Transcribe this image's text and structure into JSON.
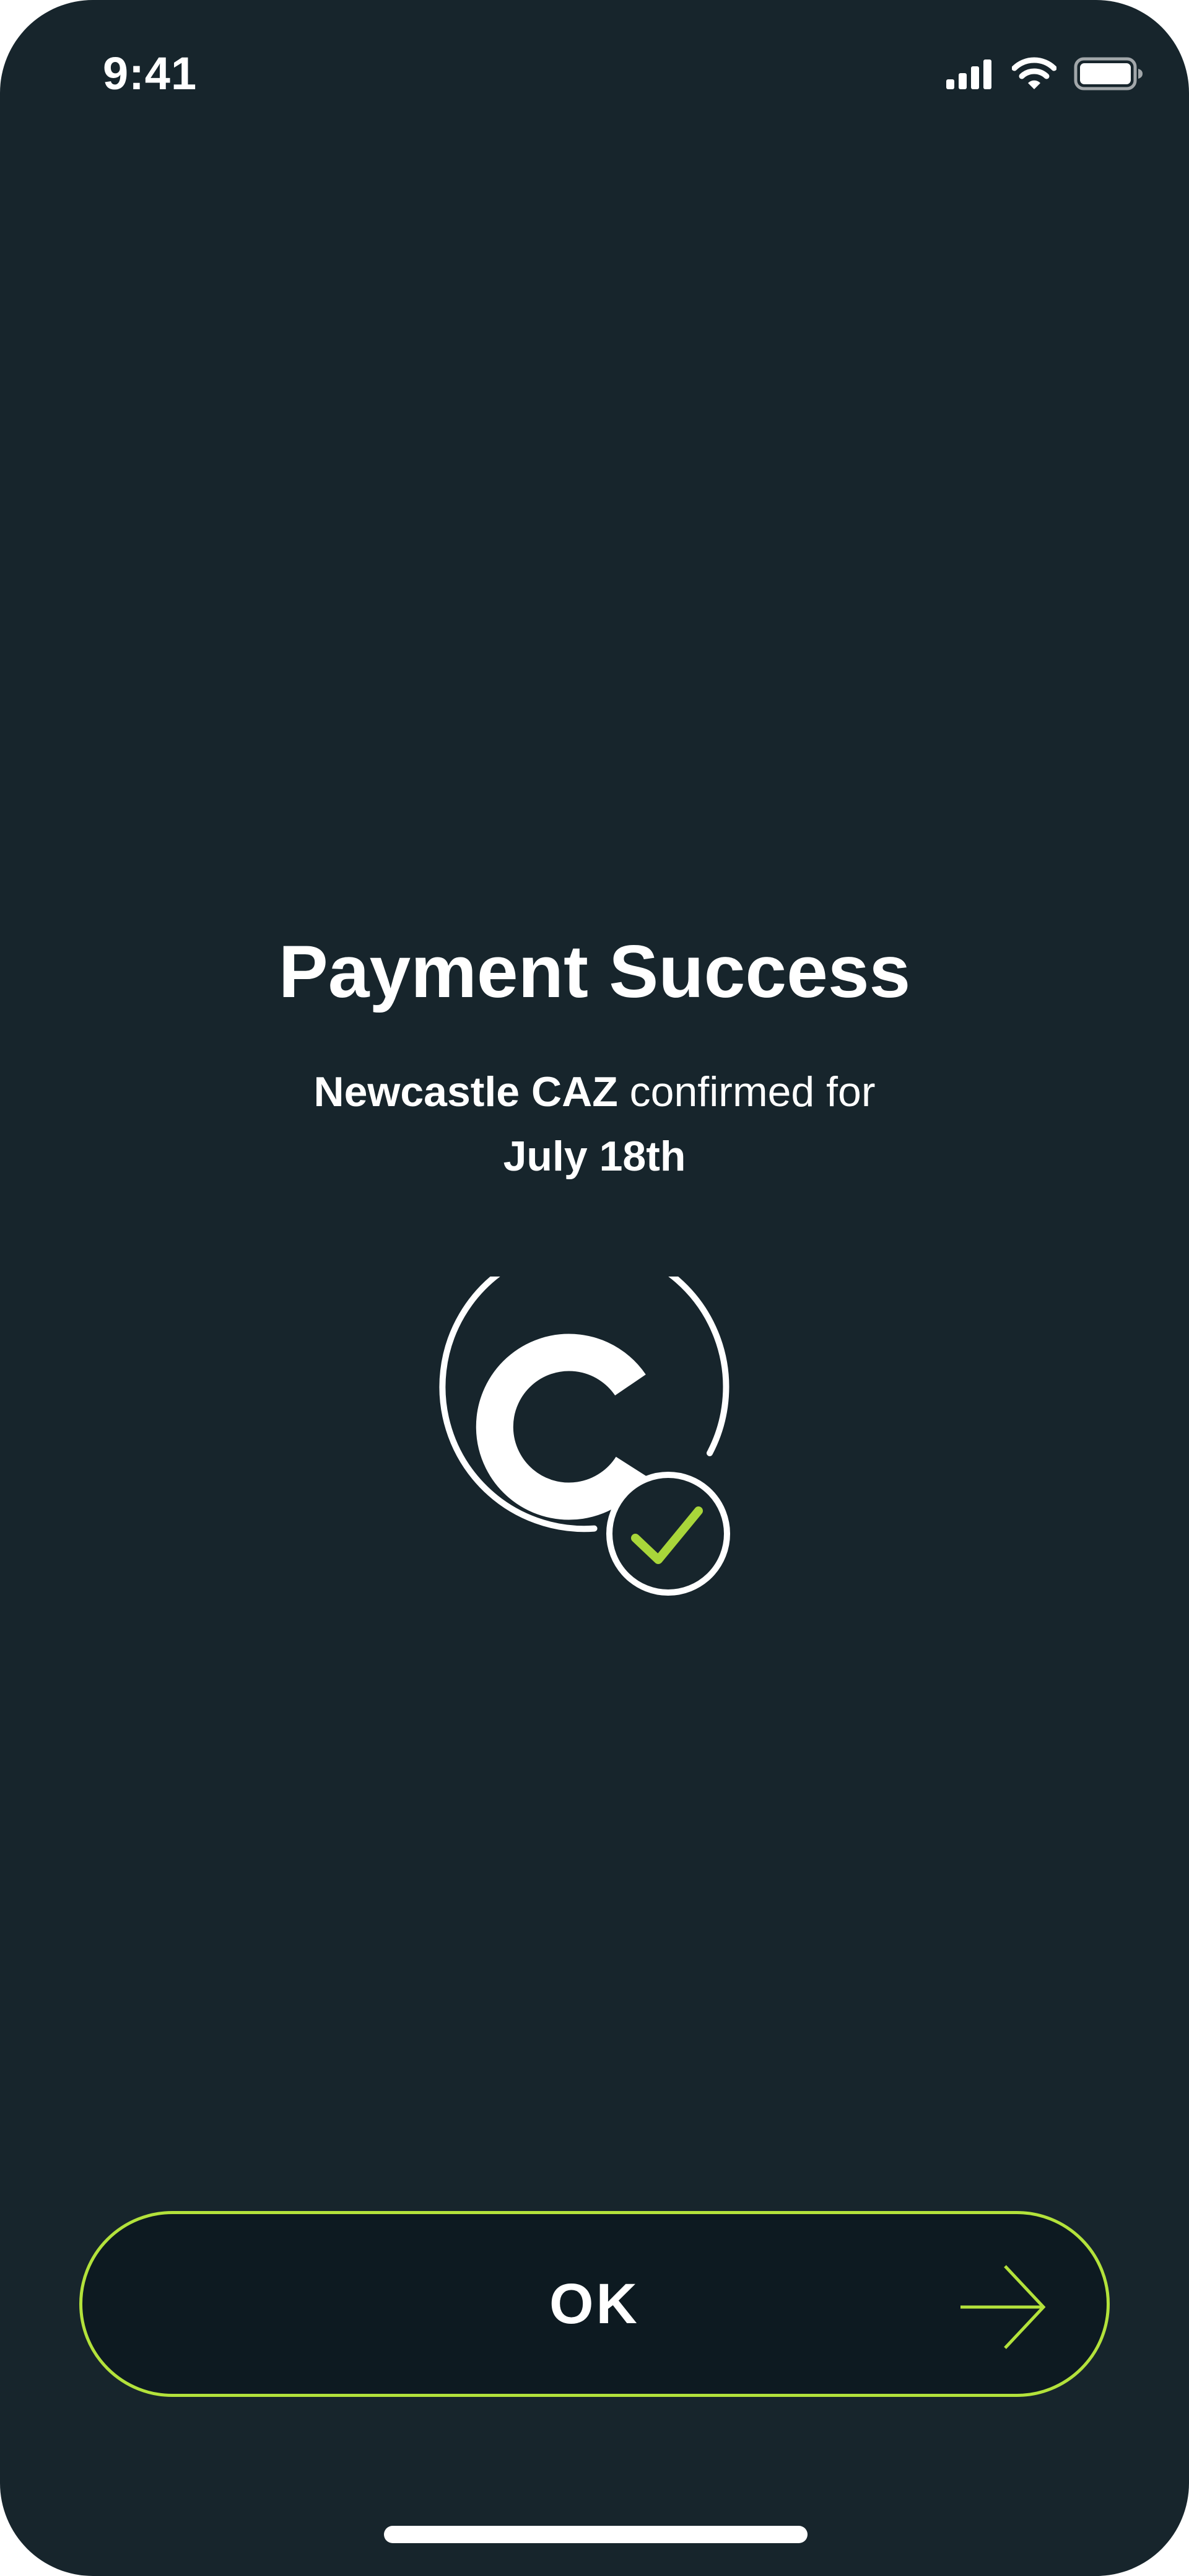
{
  "status_bar": {
    "time": "9:41",
    "icons": [
      "cellular-signal-icon",
      "wifi-icon",
      "battery-icon"
    ]
  },
  "content": {
    "title": "Payment Success",
    "zone": "Newcastle CAZ",
    "confirmed_text": " confirmed for",
    "date": "July 18th",
    "logo_icon": "caz-logo-check-icon"
  },
  "button": {
    "label": "OK",
    "icon": "arrow-right-icon"
  },
  "colors": {
    "background": "#17252c",
    "accent": "#b3e23b",
    "button_fill": "#0d1a21",
    "text": "#ffffff"
  }
}
